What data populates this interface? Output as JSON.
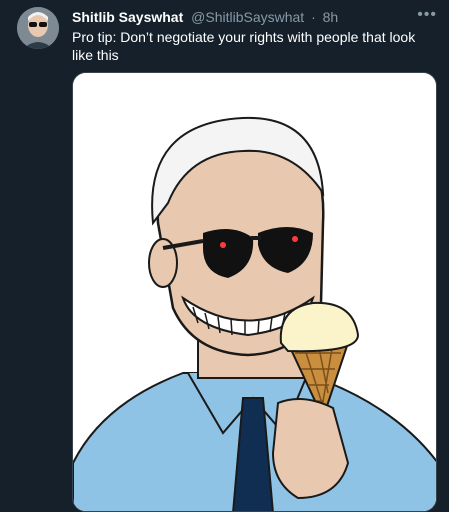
{
  "tweet": {
    "author_name": "Shitlib Sayswhat",
    "author_handle": "@ShitlibSayswhat",
    "separator": "·",
    "time": "8h",
    "more_icon": "more-icon",
    "text": "Pro tip: Don’t negotiate your rights with people that look like this"
  },
  "media": {
    "alt": "cartoon man with sunglasses, skeletal grin, holding an ice cream cone"
  },
  "colors": {
    "background": "#15202b",
    "muted": "#8899a6",
    "text": "#ffffff",
    "shirt": "#8ec3e6",
    "tie": "#0f2e52"
  }
}
